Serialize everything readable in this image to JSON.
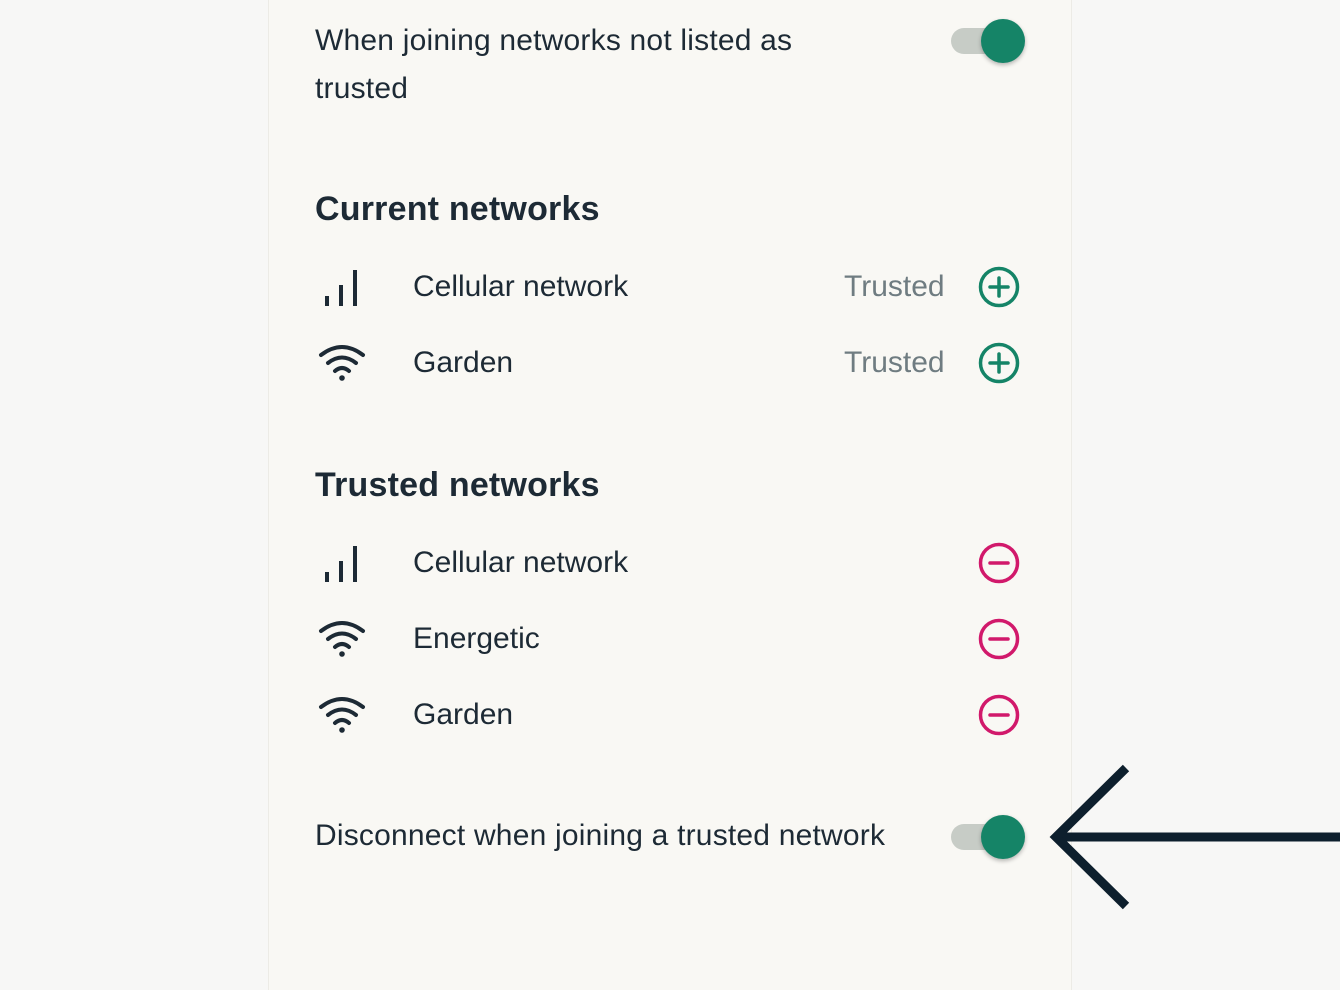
{
  "settings": {
    "untrusted_toggle": {
      "label": "When joining networks not listed as trusted",
      "on": true
    },
    "disconnect_toggle": {
      "label": "Disconnect when joining a trusted network",
      "on": true
    }
  },
  "current_networks": {
    "heading": "Current networks",
    "items": [
      {
        "icon": "cellular-signal-icon",
        "name": "Cellular network",
        "status": "Trusted",
        "action": "add-circle-icon"
      },
      {
        "icon": "wifi-icon",
        "name": "Garden",
        "status": "Trusted",
        "action": "add-circle-icon"
      }
    ]
  },
  "trusted_networks": {
    "heading": "Trusted networks",
    "items": [
      {
        "icon": "cellular-signal-icon",
        "name": "Cellular network",
        "action": "remove-circle-icon"
      },
      {
        "icon": "wifi-icon",
        "name": "Energetic",
        "action": "remove-circle-icon"
      },
      {
        "icon": "wifi-icon",
        "name": "Garden",
        "action": "remove-circle-icon"
      }
    ]
  },
  "colors": {
    "accent_green": "#158467",
    "remove_pink": "#d1196b",
    "text_dark": "#1d2a35",
    "status_gray": "#6f7c81",
    "toggle_track": "#c7ccc6",
    "arrow": "#0d1f2d"
  }
}
